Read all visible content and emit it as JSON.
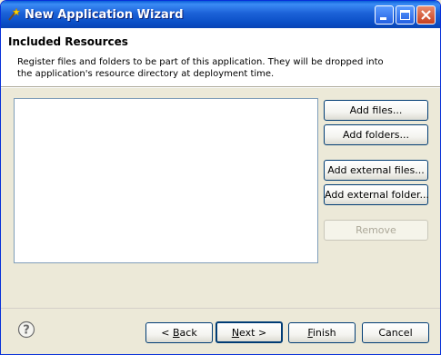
{
  "window": {
    "title": "New Application Wizard"
  },
  "header": {
    "title": "Included Resources",
    "description": "Register files and folders to be part of this application. They will be dropped into the application's resource directory at deployment time."
  },
  "resources": {
    "items": []
  },
  "side_buttons": {
    "add_files": "Add files...",
    "add_folders": "Add folders...",
    "add_external_files": "Add external files...",
    "add_external_folder": "Add external folder...",
    "remove": "Remove"
  },
  "footer": {
    "back": {
      "pre": "< ",
      "mnemonic": "B",
      "post": "ack"
    },
    "next": {
      "pre": "",
      "mnemonic": "N",
      "post": "ext >"
    },
    "finish": {
      "pre": "",
      "mnemonic": "F",
      "post": "inish"
    },
    "cancel": "Cancel"
  },
  "icons": {
    "app": "wizard-icon",
    "minimize": "minimize-icon",
    "maximize": "maximize-icon",
    "close": "close-icon",
    "help": "help-icon"
  }
}
